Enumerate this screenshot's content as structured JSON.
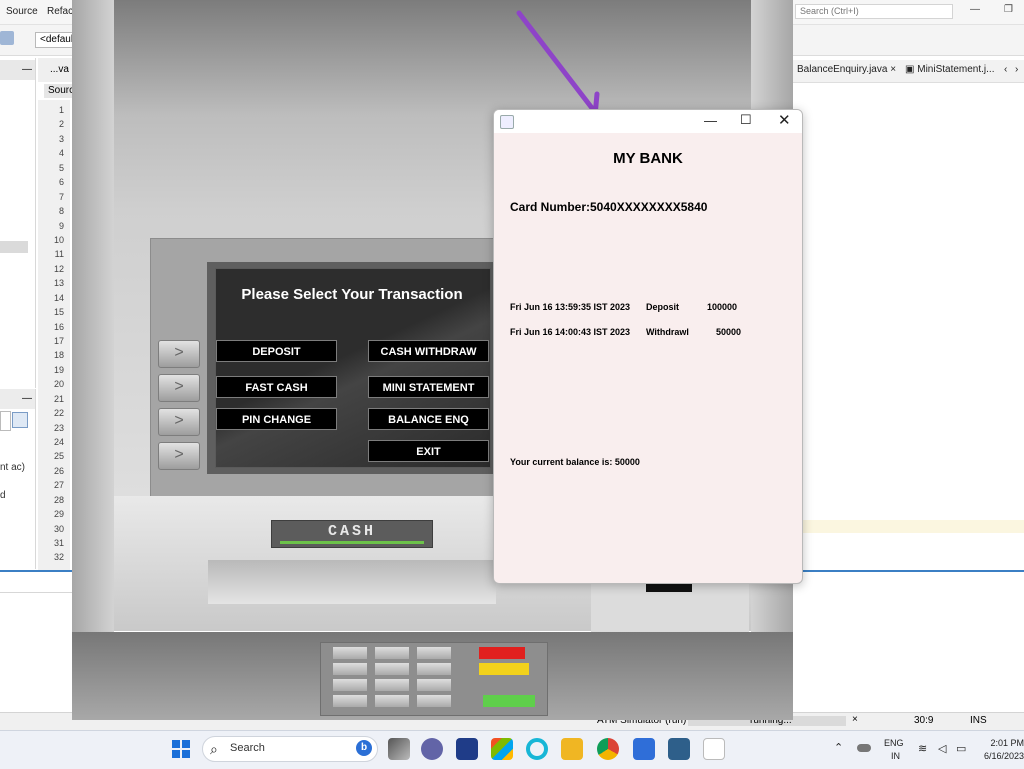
{
  "ide": {
    "menu": [
      "Source",
      "Refac"
    ],
    "search_placeholder": "Search (Ctrl+I)",
    "toolbar_combo": "<defaul",
    "editor_tab": "...va",
    "source_tab": "Sourc",
    "right_tabs": [
      "BalanceEnquiry.java",
      "MiniStatement.j..."
    ],
    "line_numbers": [
      "1",
      "2",
      "3",
      "4",
      "5",
      "6",
      "7",
      "8",
      "9",
      "10",
      "11",
      "12",
      "13",
      "14",
      "15",
      "16",
      "17",
      "18",
      "19",
      "20",
      "21",
      "22",
      "23",
      "24",
      "25",
      "26",
      "27",
      "28",
      "29",
      "30",
      "31",
      "32"
    ],
    "left_fragments": [
      "nt ac)",
      "d"
    ],
    "status": {
      "process": "ATM Simulator (run)",
      "running": "running...",
      "position": "30:9",
      "mode": "INS"
    }
  },
  "atm": {
    "screen_title": "Please Select Your Transaction",
    "buttons": {
      "deposit": "DEPOSIT",
      "cash_withdraw": "CASH WITHDRAW",
      "fast_cash": "FAST CASH",
      "mini_statement": "MINI STATEMENT",
      "pin_change": "PIN CHANGE",
      "balance_enq": "BALANCE ENQ",
      "exit": "EXIT"
    },
    "cash_label": "CASH"
  },
  "statement": {
    "bank_name": "MY BANK",
    "card_number": "Card Number:5040XXXXXXXX5840",
    "transactions": [
      {
        "date": "Fri Jun 16 13:59:35 IST 2023",
        "type": "Deposit",
        "amount": "100000"
      },
      {
        "date": "Fri Jun 16 14:00:43 IST 2023",
        "type": "Withdrawl",
        "amount": "50000"
      }
    ],
    "balance": "Your current balance is: 50000"
  },
  "taskbar": {
    "search": "Search",
    "lang": "ENG",
    "region": "IN",
    "time": "2:01 PM",
    "date": "6/16/2023"
  },
  "colors": {
    "atm_screen": "#2d2d2d",
    "dialog_bg": "#f9eeee",
    "arrow": "#8e44c8",
    "cash_bar": "#6cc24a"
  }
}
